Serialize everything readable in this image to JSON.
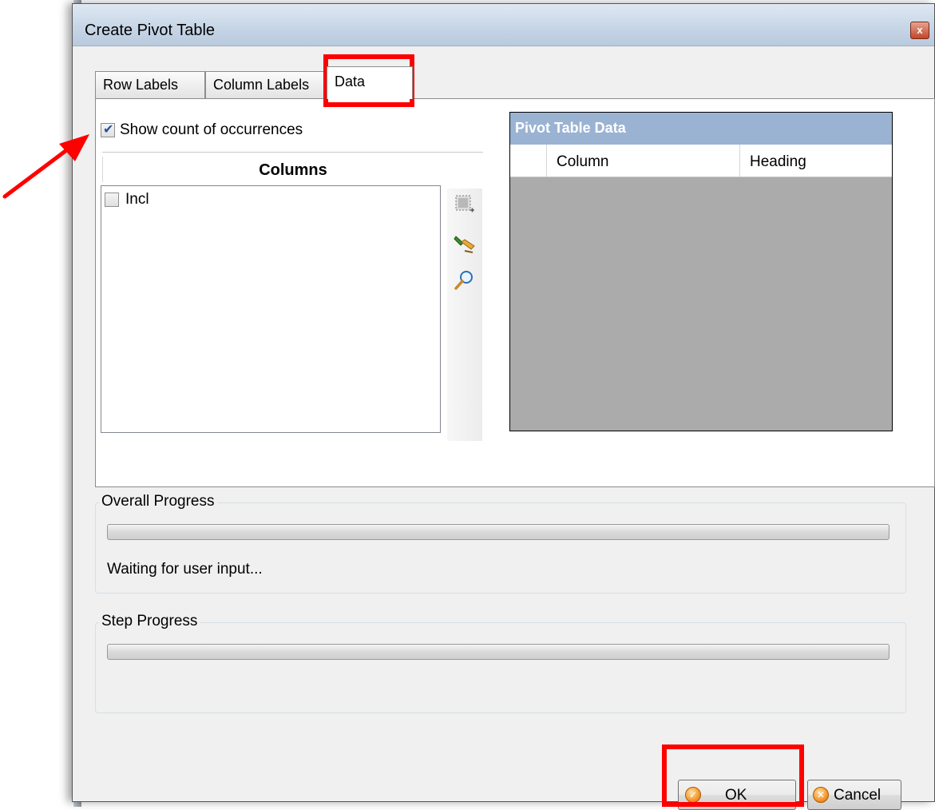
{
  "window": {
    "title": "Create Pivot Table",
    "close_glyph": "x"
  },
  "tabs": [
    {
      "label": "Row Labels",
      "active": false
    },
    {
      "label": "Column Labels",
      "active": false
    },
    {
      "label": "Data",
      "active": true
    }
  ],
  "data_tab": {
    "show_count_label": "Show count of occurrences",
    "show_count_checked": true,
    "columns_header": "Columns",
    "columns_items": [
      {
        "label": "Incl",
        "checked": false
      }
    ],
    "toolbar_icons": [
      "select-all-icon",
      "brush-icon",
      "magnifier-icon"
    ],
    "pivot_caption": "Pivot Table Data",
    "pivot_headers": [
      "Column",
      "Heading"
    ]
  },
  "overall_progress": {
    "title": "Overall Progress",
    "value": 0,
    "status": "Waiting for user input..."
  },
  "step_progress": {
    "title": "Step Progress",
    "value": 0
  },
  "buttons": {
    "ok_label": "OK",
    "cancel_label": "Cancel"
  },
  "colors": {
    "annotation": "#ff0000",
    "grid_caption": "#9bb3d2",
    "grid_empty": "#ababab"
  }
}
